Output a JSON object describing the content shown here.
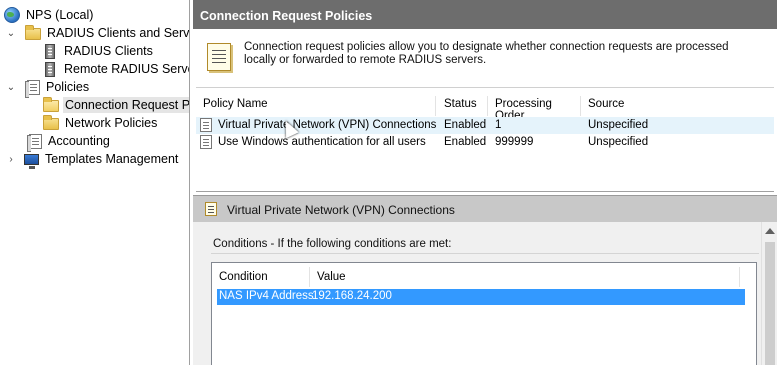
{
  "tree": {
    "items": [
      {
        "label": "NPS (Local)",
        "icon": "globe-icon",
        "chevron": ""
      },
      {
        "label": "RADIUS Clients and Servers",
        "icon": "folder-icon",
        "chevron": "⌄"
      },
      {
        "label": "RADIUS Clients",
        "icon": "server-icon",
        "chevron": ""
      },
      {
        "label": "Remote RADIUS Server",
        "icon": "server-icon",
        "chevron": ""
      },
      {
        "label": "Policies",
        "icon": "policy-doc-icon",
        "chevron": "⌄"
      },
      {
        "label": "Connection Request Po",
        "icon": "open-folder-icon",
        "chevron": ""
      },
      {
        "label": "Network Policies",
        "icon": "folder-icon",
        "chevron": ""
      },
      {
        "label": "Accounting",
        "icon": "policy-doc-icon",
        "chevron": ""
      },
      {
        "label": "Templates Management",
        "icon": "monitor-icon",
        "chevron": "›"
      }
    ]
  },
  "main": {
    "title": "Connection Request Policies",
    "intro_text": "Connection request policies allow you to designate whether connection requests are processed locally or forwarded to remote RADIUS servers.",
    "columns": [
      "Policy Name",
      "Status",
      "Processing Order",
      "Source"
    ],
    "rows": [
      {
        "name": "Virtual Private Network (VPN) Connections",
        "status": "Enabled",
        "order": "1",
        "source": "Unspecified"
      },
      {
        "name": "Use Windows authentication for all users",
        "status": "Enabled",
        "order": "999999",
        "source": "Unspecified"
      }
    ]
  },
  "details": {
    "title": "Virtual Private Network (VPN) Connections",
    "conditions_label": "Conditions - If the following conditions are met:",
    "columns": [
      "Condition",
      "Value"
    ],
    "rows": [
      {
        "condition": "NAS IPv4 Address",
        "value": "192.168.24.200"
      }
    ]
  },
  "colors": {
    "header_bg": "#6d6d6d",
    "selection": "#3399ff",
    "hover_row": "#e5f3fb"
  }
}
